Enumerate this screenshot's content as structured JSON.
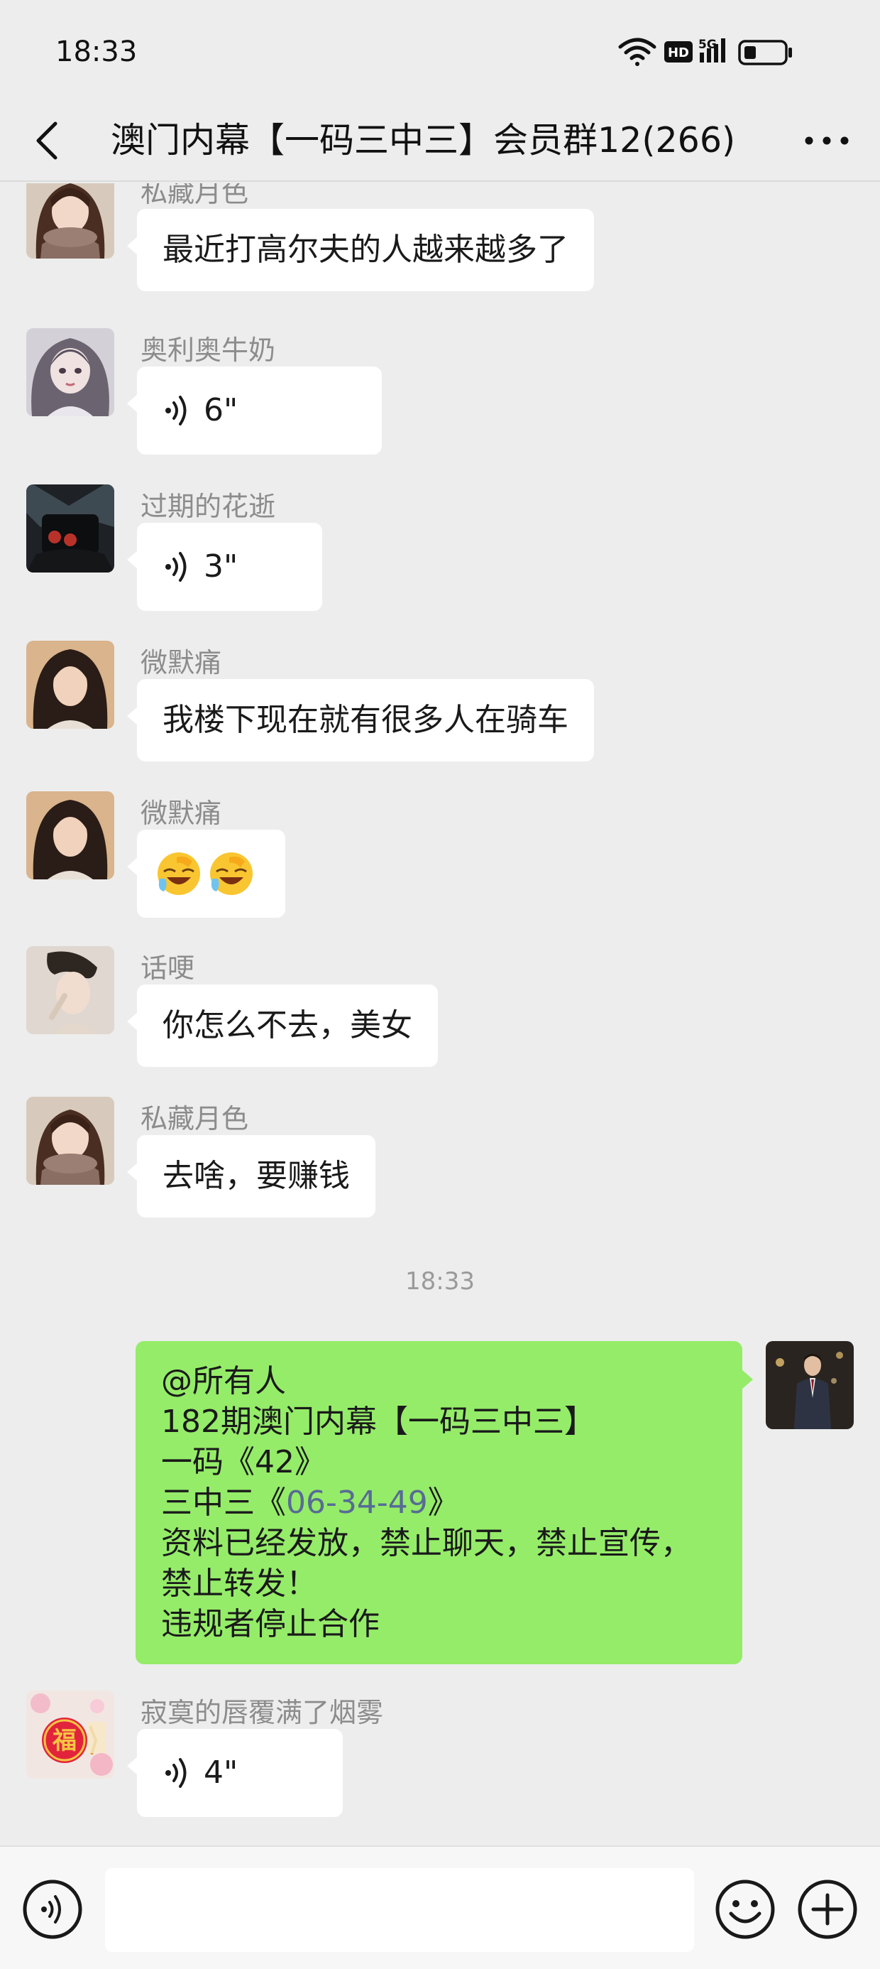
{
  "status_bar": {
    "time": "18:33",
    "icons": [
      "wifi-icon",
      "hd-icon",
      "5g-signal-icon",
      "battery-icon"
    ],
    "hd_label": "HD",
    "network_label": "5G"
  },
  "header": {
    "title": "澳门内幕【一码三中三】会员群12(266)",
    "back_icon": "chevron-left-icon",
    "more_icon": "more-dots-icon"
  },
  "messages": [
    {
      "type": "text",
      "sender": "私藏月色",
      "text": "最近打高尔夫的人越来越多了"
    },
    {
      "type": "voice",
      "sender": "奥利奥牛奶",
      "duration": "6\""
    },
    {
      "type": "voice",
      "sender": "过期的花逝",
      "duration": "3\""
    },
    {
      "type": "text",
      "sender": "微默痛",
      "text": "我楼下现在就有很多人在骑车"
    },
    {
      "type": "emoji",
      "sender": "微默痛",
      "emojis": [
        "facepalm-laugh-emoji",
        "facepalm-laugh-emoji"
      ]
    },
    {
      "type": "text",
      "sender": "话哽",
      "text": "你怎么不去，美女"
    },
    {
      "type": "text",
      "sender": "私藏月色",
      "text": "去啥，要赚钱"
    }
  ],
  "time_divider": "18:33",
  "self_message": {
    "lines": [
      "@所有人",
      "182期澳门内幕【一码三中三】",
      "一码《42》",
      "资料已经发放，禁止聊天，禁止宣传，",
      "禁止转发！",
      "违规者停止合作"
    ],
    "line4_prefix": "三中三《",
    "line4_link": "06-34-49",
    "line4_suffix": "》"
  },
  "last_message": {
    "type": "voice",
    "sender": "寂寞的唇覆满了烟雾",
    "duration": "4\"",
    "avatar_char": "福"
  },
  "input_bar": {
    "placeholder": "",
    "voice_icon": "voice-input-icon",
    "emoji_icon": "emoji-icon",
    "plus_icon": "plus-circle-icon"
  },
  "colors": {
    "background": "#ededed",
    "self_bubble": "#95ec69",
    "other_bubble": "#ffffff",
    "sender_name": "#8c8c8c",
    "link": "#576b95"
  }
}
